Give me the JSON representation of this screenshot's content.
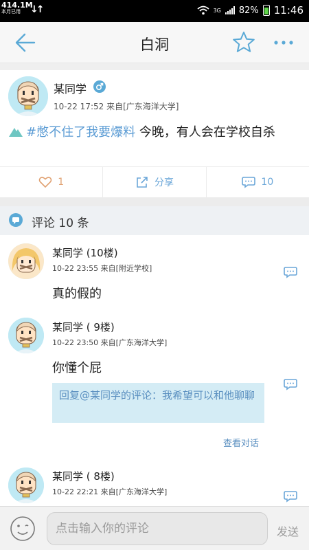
{
  "status_bar": {
    "speed": "414.1M",
    "speed_sub": "本月已用",
    "network": "3G",
    "battery": "82%",
    "time": "11:46"
  },
  "title_bar": {
    "title": "白洞",
    "icons": {
      "back": "back-arrow-icon",
      "favorite": "star-icon",
      "more": "more-dots-icon"
    },
    "accent_color": "#5aa9d6"
  },
  "post": {
    "author": "某同学",
    "gender": "male",
    "time": "10-22 17:52",
    "source": "来自[广东海洋大学]",
    "hashtag": "#憋不住了我要爆料",
    "text": " 今晚，有人会在学校自杀"
  },
  "actions": {
    "like_count": "1",
    "share_label": "分享",
    "comment_count": "10"
  },
  "comments_header": {
    "label": "评论 10 条"
  },
  "comments": [
    {
      "author": "某同学 (10楼)",
      "time": "10-22 23:55",
      "source": "来自[附近学校]",
      "text": "真的假的",
      "avatar": "girl"
    },
    {
      "author": "某同学 ( 9楼)",
      "time": "10-22 23:50",
      "source": "来自[广东海洋大学]",
      "text": "你懂个屁",
      "reply": "回复@某同学的评论：我希望可以和他聊聊",
      "view_conversation": "查看对话",
      "avatar": "boy"
    },
    {
      "author": "某同学 ( 8楼)",
      "time": "10-22 22:21",
      "source": "来自[广东海洋大学]",
      "avatar": "boy"
    }
  ],
  "input_bar": {
    "placeholder": "点击输入你的评论",
    "send_label": "发送"
  }
}
